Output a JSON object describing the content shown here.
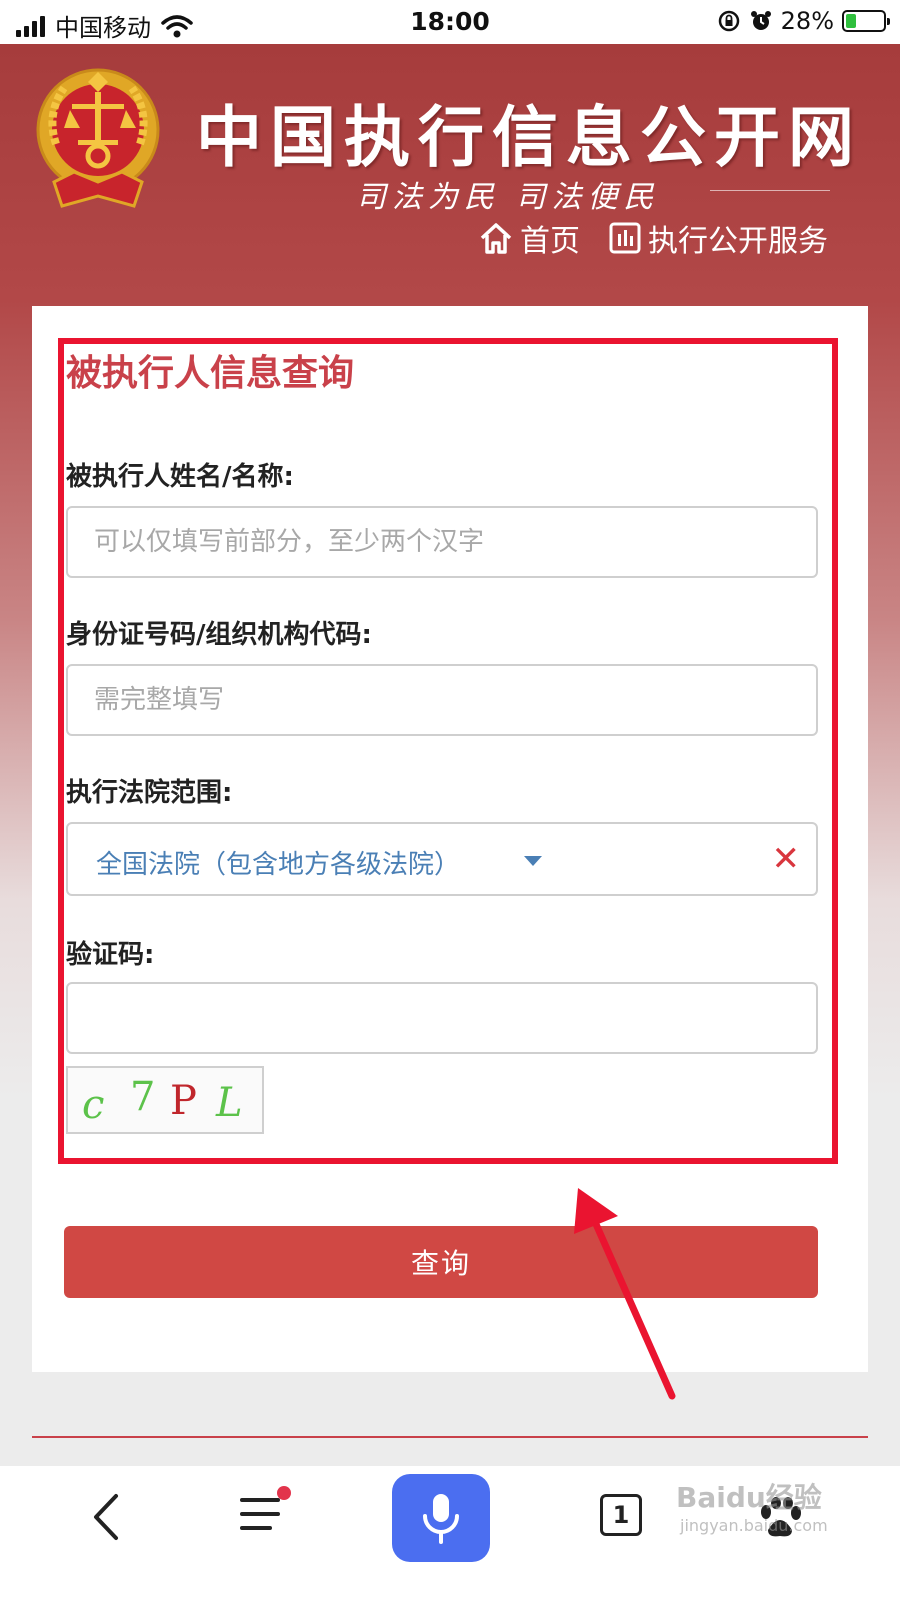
{
  "status_bar": {
    "carrier": "中国移动",
    "time": "18:00",
    "battery": "28%",
    "battery_level": 0.28
  },
  "header": {
    "title": "中国执行信息公开网",
    "slogan": "司法为民  司法便民",
    "nav": [
      {
        "label": "首页",
        "icon": "home-icon"
      },
      {
        "label": "执行公开服务",
        "icon": "chart-icon"
      }
    ]
  },
  "form": {
    "title": "被执行人信息查询",
    "name_label": "被执行人姓名/名称:",
    "name_placeholder": "可以仅填写前部分，至少两个汉字",
    "name_value": "",
    "id_label": "身份证号码/组织机构代码:",
    "id_placeholder": "需完整填写",
    "id_value": "",
    "court_label": "执行法院范围:",
    "court_value": "全国法院（包含地方各级法院）",
    "captcha_label": "验证码:",
    "captcha_value": "",
    "captcha_text": "c7PL",
    "submit_label": "查询"
  },
  "toolbar": {
    "tabs_count": "1",
    "watermark": "Baidu经验",
    "watermark_sub": "jingyan.baidu.com"
  },
  "colors": {
    "brand_red": "#c9414a",
    "highlight_red": "#ea1430",
    "button_red": "#d04844",
    "mic_blue": "#4b6ef0",
    "select_blue": "#4a7fb5"
  }
}
